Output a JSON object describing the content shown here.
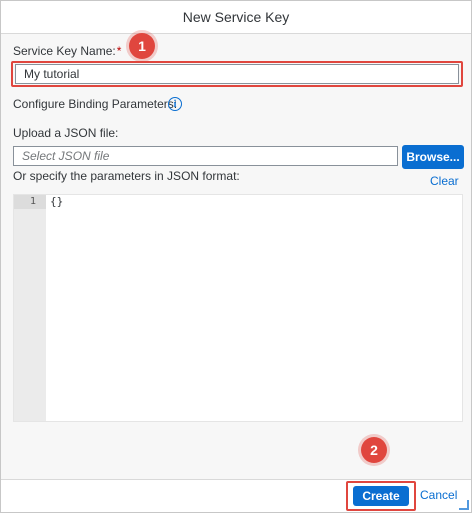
{
  "dialog": {
    "title": "New Service Key"
  },
  "form": {
    "service_key_label": "Service Key Name:",
    "required_mark": "*",
    "service_key_value": "My tutorial",
    "binding_params_label": "Configure Binding Parameters:",
    "info_icon_glyph": "i",
    "upload_label": "Upload a JSON file:",
    "json_file_placeholder": "Select JSON file",
    "browse_label": "Browse...",
    "specify_label": "Or specify the parameters in JSON format:",
    "clear_label": "Clear"
  },
  "editor": {
    "line_number": "1",
    "line_content": "{}"
  },
  "annotations": {
    "step1": "1",
    "step2": "2",
    "color": "#e0463e"
  },
  "footer": {
    "create_label": "Create",
    "cancel_label": "Cancel"
  },
  "colors": {
    "accent": "#0a6ed1",
    "required": "#bb0000"
  }
}
